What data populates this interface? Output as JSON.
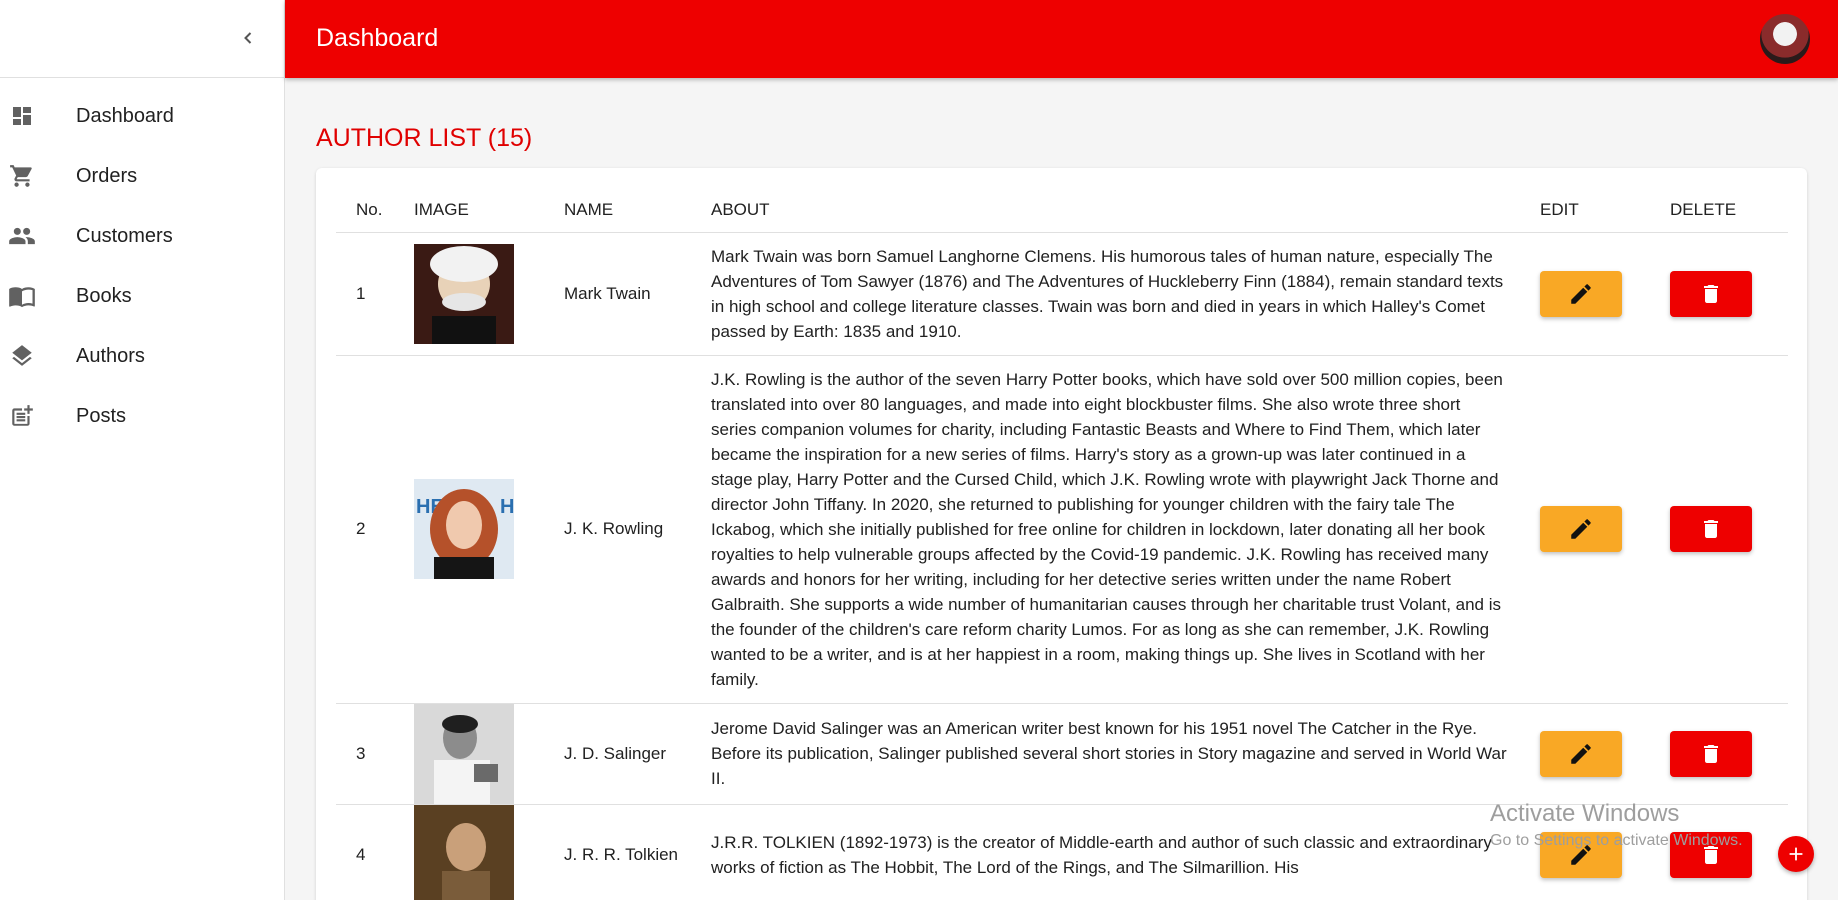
{
  "appbar": {
    "title": "Dashboard",
    "avatar_icon": "user-avatar"
  },
  "sidebar": {
    "collapse_icon": "chevron-left-icon",
    "items": [
      {
        "label": "Dashboard",
        "icon": "dashboard-icon"
      },
      {
        "label": "Orders",
        "icon": "cart-icon"
      },
      {
        "label": "Customers",
        "icon": "people-icon"
      },
      {
        "label": "Books",
        "icon": "book-icon"
      },
      {
        "label": "Authors",
        "icon": "layers-icon"
      },
      {
        "label": "Posts",
        "icon": "post-add-icon"
      }
    ]
  },
  "main": {
    "title": "AUTHOR LIST (15)",
    "table": {
      "headers": [
        "No.",
        "IMAGE",
        "NAME",
        "ABOUT",
        "EDIT",
        "DELETE"
      ],
      "rows": [
        {
          "no": "1",
          "name": "Mark Twain",
          "about": "Mark Twain was born Samuel Langhorne Clemens. His humorous tales of human nature, especially The Adventures of Tom Sawyer (1876) and The Adventures of Huckleberry Finn (1884), remain standard texts in high school and college literature classes. Twain was born and died in years in which Halley's Comet passed by Earth: 1835 and 1910."
        },
        {
          "no": "2",
          "name": "J. K. Rowling",
          "about": "J.K. Rowling is the author of the seven Harry Potter books, which have sold over 500 million copies, been translated into over 80 languages, and made into eight blockbuster films. She also wrote three short series companion volumes for charity, including Fantastic Beasts and Where to Find Them, which later became the inspiration for a new series of films. Harry's story as a grown-up was later continued in a stage play, Harry Potter and the Cursed Child, which J.K. Rowling wrote with playwright Jack Thorne and director John Tiffany. In 2020, she returned to publishing for younger children with the fairy tale The Ickabog, which she initially published for free online for children in lockdown, later donating all her book royalties to help vulnerable groups affected by the Covid-19 pandemic. J.K. Rowling has received many awards and honors for her writing, including for her detective series written under the name Robert Galbraith. She supports a wide number of humanitarian causes through her charitable trust Volant, and is the founder of the children's care reform charity Lumos. For as long as she can remember, J.K. Rowling wanted to be a writer, and is at her happiest in a room, making things up. She lives in Scotland with her family."
        },
        {
          "no": "3",
          "name": "J. D. Salinger",
          "about": "Jerome David Salinger was an American writer best known for his 1951 novel The Catcher in the Rye. Before its publication, Salinger published several short stories in Story magazine and served in World War II."
        },
        {
          "no": "4",
          "name": "J. R. R. Tolkien",
          "about": "J.R.R. TOLKIEN (1892-1973) is the creator of Middle-earth and author of such classic and extraordinary works of fiction as The Hobbit, The Lord of the Rings, and The Silmarillion. His"
        }
      ]
    }
  },
  "watermark": {
    "title": "Activate Windows",
    "subtitle": "Go to Settings to activate Windows."
  },
  "colors": {
    "primary": "#ee0000",
    "edit": "#f9a825"
  }
}
